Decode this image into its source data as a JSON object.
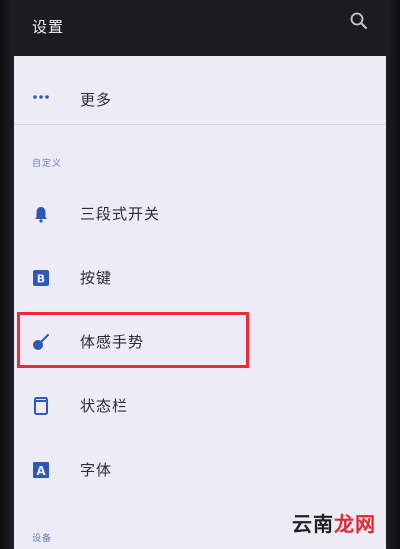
{
  "header": {
    "title": "设置",
    "search_icon": "search-icon"
  },
  "items": [
    {
      "id": "more",
      "label": "更多",
      "icon": "more-dots-icon"
    }
  ],
  "sections": [
    {
      "title": "自定义",
      "items": [
        {
          "id": "three-stage-switch",
          "label": "三段式开关",
          "icon": "bell-icon"
        },
        {
          "id": "buttons",
          "label": "按键",
          "icon": "b-key-icon"
        },
        {
          "id": "gestures",
          "label": "体感手势",
          "icon": "gesture-icon"
        },
        {
          "id": "status-bar",
          "label": "状态栏",
          "icon": "phone-outline-icon"
        },
        {
          "id": "font",
          "label": "字体",
          "icon": "font-a-icon"
        }
      ]
    },
    {
      "title": "设备"
    }
  ],
  "annotation": {
    "highlighted_item": "体感手势",
    "highlight_color": "#ee2b3a"
  },
  "watermark": {
    "part1": "云南",
    "part2": "龙网"
  },
  "colors": {
    "accent": "#2d58b8",
    "header_bg": "#1b1c20",
    "content_bg": "#ecebf6"
  }
}
